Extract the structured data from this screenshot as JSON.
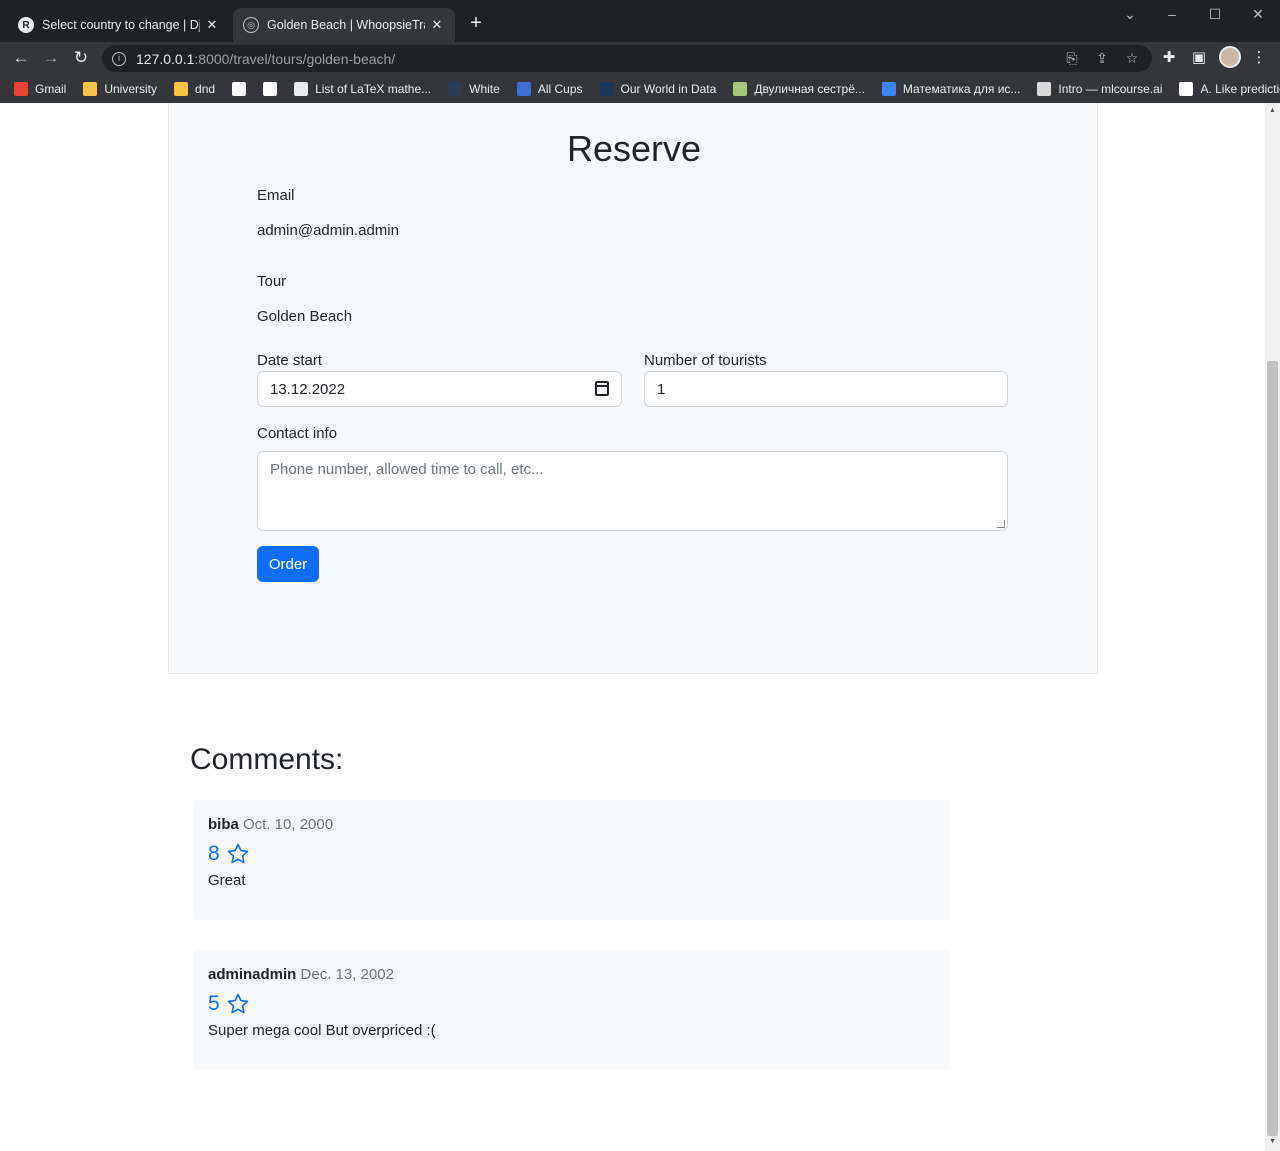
{
  "browser": {
    "tabs": [
      {
        "title": "Select country to change | Django",
        "active": false
      },
      {
        "title": "Golden Beach | WhoopsieTravel",
        "active": true
      }
    ],
    "url_host": "127.0.0.1",
    "url_path": ":8000/travel/tours/golden-beach/",
    "bookmarks": [
      {
        "label": "Gmail",
        "icon": "gmail-icon",
        "color": "#ea4335"
      },
      {
        "label": "University",
        "icon": "folder-icon",
        "color": "#f6c343"
      },
      {
        "label": "dnd",
        "icon": "folder-icon",
        "color": "#f6c343"
      },
      {
        "label": "",
        "icon": "circle-p-icon",
        "color": "#ffffff"
      },
      {
        "label": "",
        "icon": "github-icon",
        "color": "#ffffff"
      },
      {
        "label": "List of LaTeX mathe...",
        "icon": "latex-icon",
        "color": "#e8eaed"
      },
      {
        "label": "White",
        "icon": "square-icon",
        "color": "#2b3a55"
      },
      {
        "label": "All Cups",
        "icon": "cup-icon",
        "color": "#3b6fd6"
      },
      {
        "label": "Our World in Data",
        "icon": "owid-icon",
        "color": "#1d3557"
      },
      {
        "label": "Двуличная сестрё...",
        "icon": "globe-icon",
        "color": "#a8c47a"
      },
      {
        "label": "Математика для ис...",
        "icon": "star-badge-icon",
        "color": "#3a86ff"
      },
      {
        "label": "Intro — mlcourse.ai",
        "icon": "mlcourse-icon",
        "color": "#d9d9d9"
      },
      {
        "label": "A. Like prediction...",
        "icon": "yandex-icon",
        "color": "#ffffff"
      }
    ]
  },
  "reserve": {
    "title": "Reserve",
    "email_label": "Email",
    "email_value": "admin@admin.admin",
    "tour_label": "Tour",
    "tour_value": "Golden Beach",
    "date_label": "Date start",
    "date_value": "13.12.2022",
    "tourists_label": "Number of tourists",
    "tourists_value": "1",
    "contact_label": "Contact info",
    "contact_placeholder": "Phone number, allowed time to call, etc...",
    "order_label": "Order"
  },
  "comments": {
    "heading": "Comments:",
    "items": [
      {
        "user": "biba",
        "date": "Oct. 10, 2000",
        "rating": "8",
        "text": "Great"
      },
      {
        "user": "adminadmin",
        "date": "Dec. 13, 2002",
        "rating": "5",
        "text": "Super mega cool But overpriced :("
      }
    ]
  },
  "colors": {
    "primary": "#0d6efd",
    "panel_bg": "#f8f9fa",
    "chrome_dark": "#202124",
    "chrome_toolbar": "#35363a"
  }
}
